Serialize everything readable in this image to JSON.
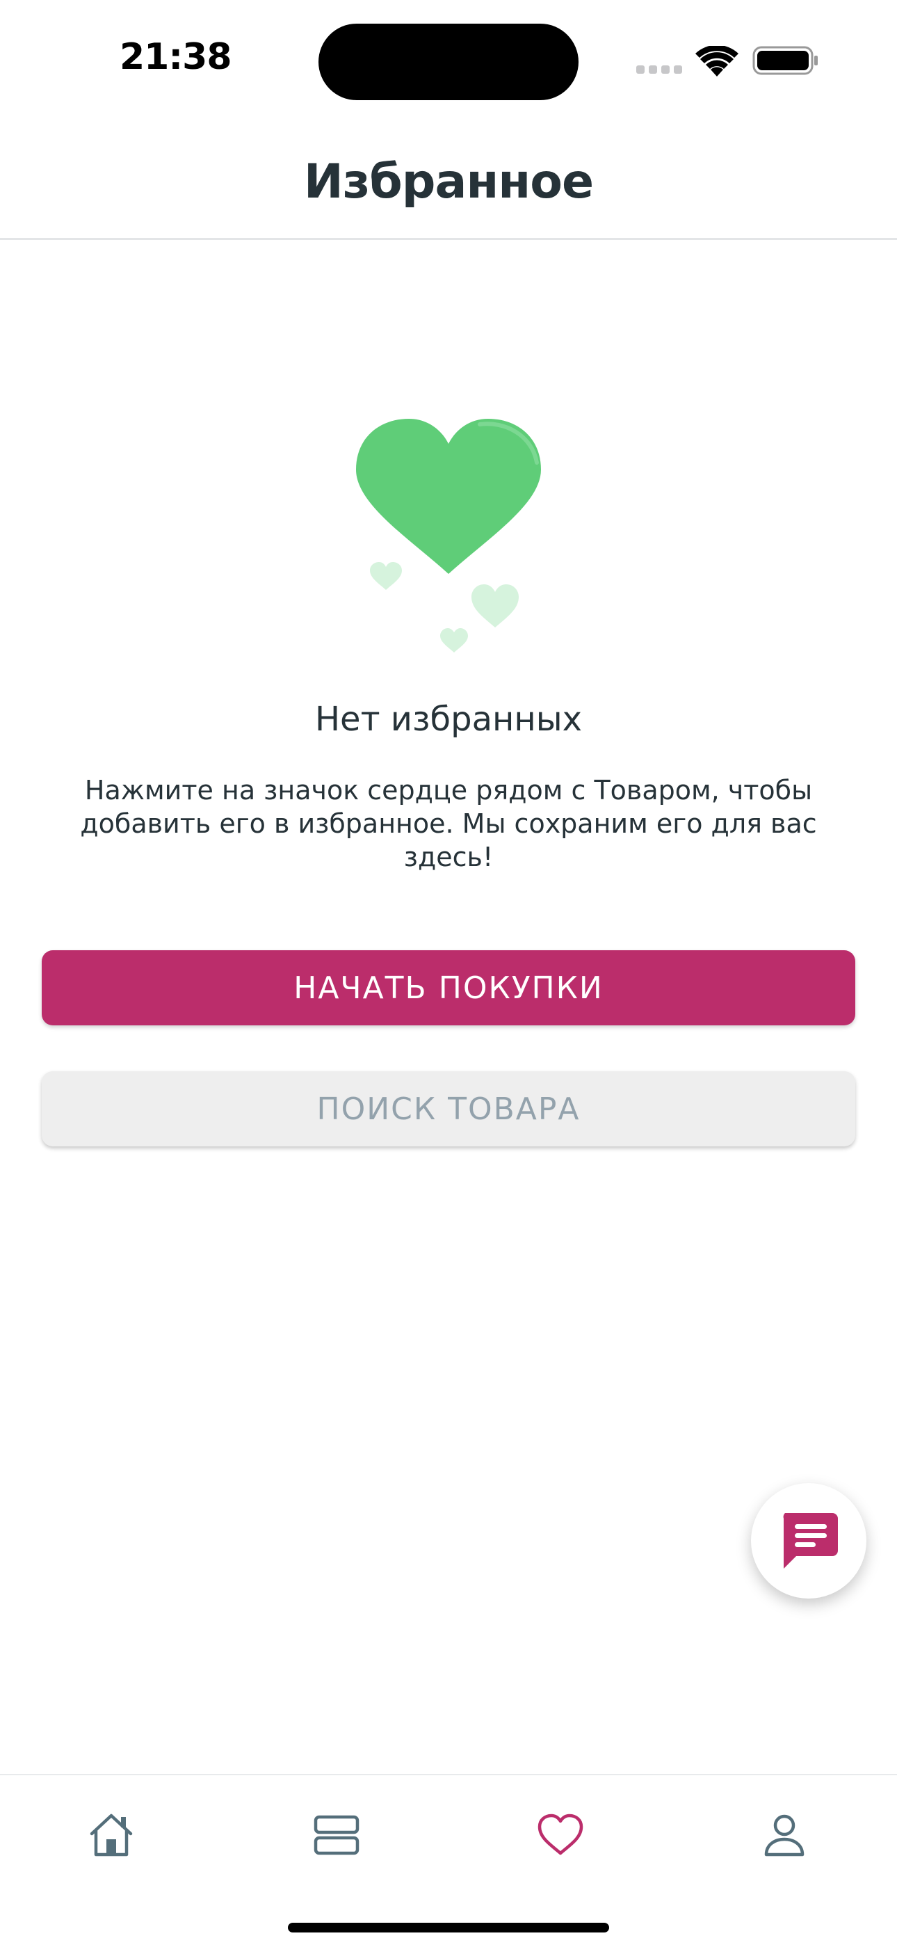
{
  "status_bar": {
    "time": "21:38"
  },
  "header": {
    "title": "Избранное"
  },
  "empty_state": {
    "title": "Нет избранных",
    "description": "Нажмите на значок сердце рядом с Товаром, чтобы добавить его в избранное. Мы сохраним его для вас здесь!",
    "illustration_icon": "hearts-icon"
  },
  "buttons": {
    "start_shopping": "НАЧАТЬ ПОКУПКИ",
    "search_product": "ПОИСК ТОВАРА"
  },
  "chat": {
    "icon": "chat-icon"
  },
  "bottom_nav": {
    "items": [
      {
        "icon": "home-icon",
        "active": false
      },
      {
        "icon": "catalog-icon",
        "active": false
      },
      {
        "icon": "heart-icon",
        "active": true
      },
      {
        "icon": "profile-icon",
        "active": false
      }
    ]
  },
  "colors": {
    "primary": "#bb2d6b",
    "heart_green": "#5fcd78",
    "text": "#263238",
    "secondary_text": "#93a2ac",
    "nav_icon": "#546e7a"
  }
}
